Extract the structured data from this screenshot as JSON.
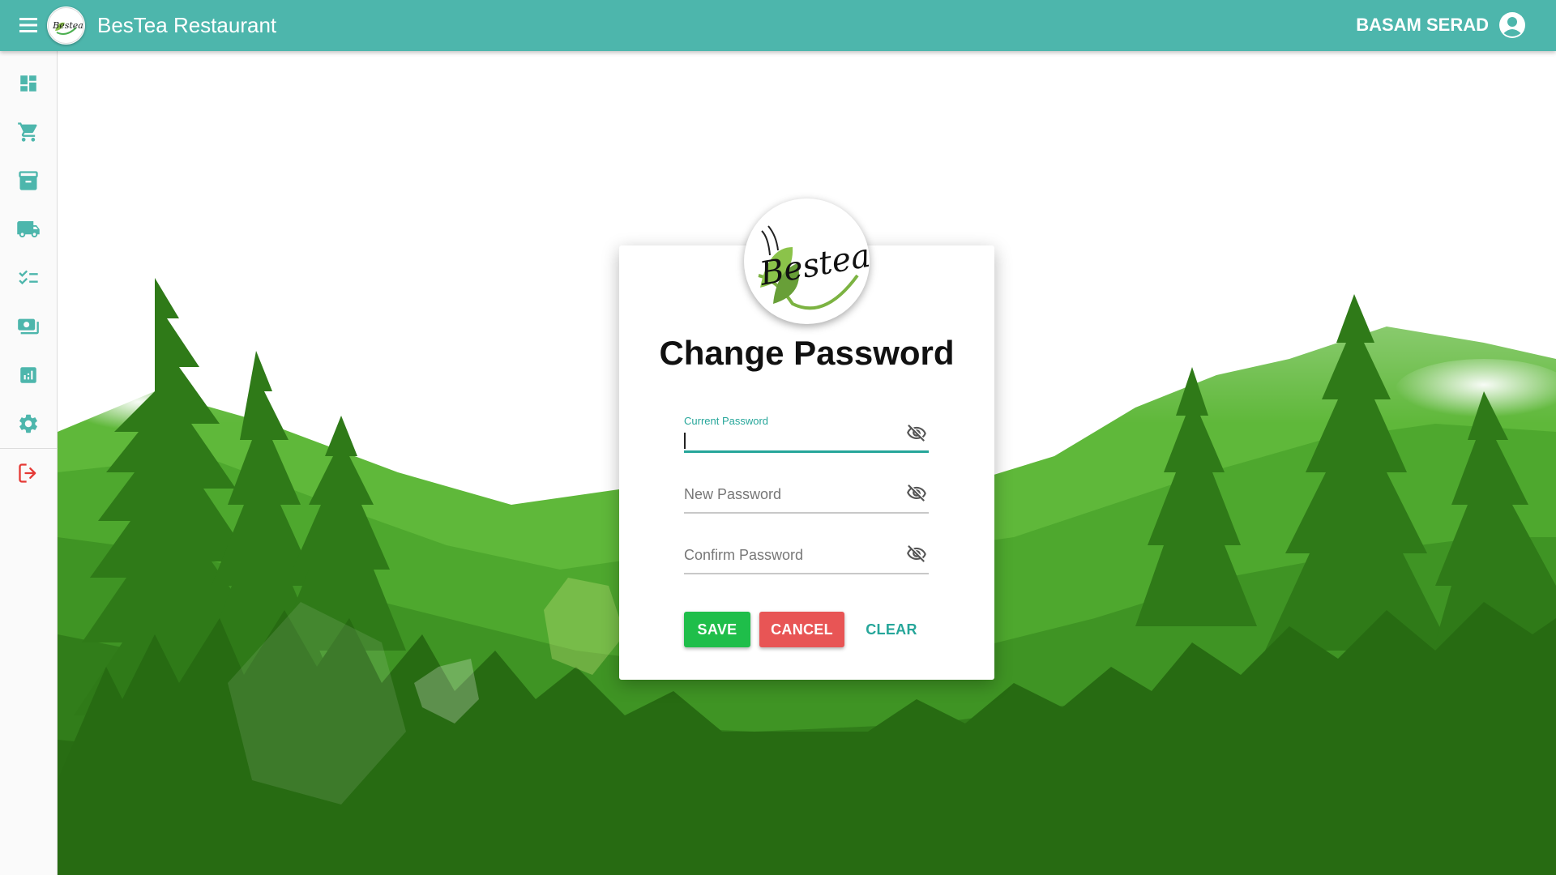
{
  "app": {
    "title": "BesTea Restaurant",
    "user_name": "BASAM SERAD",
    "accent": "#4db6ac"
  },
  "sidebar": {
    "items": [
      {
        "icon": "dashboard-icon"
      },
      {
        "icon": "cart-icon"
      },
      {
        "icon": "archive-icon"
      },
      {
        "icon": "truck-icon"
      },
      {
        "icon": "checklist-icon"
      },
      {
        "icon": "payments-icon"
      },
      {
        "icon": "report-icon"
      },
      {
        "icon": "gear-icon"
      },
      {
        "icon": "logout-icon"
      }
    ]
  },
  "form": {
    "title": "Change Password",
    "current_password_label": "Current Password",
    "new_password_placeholder": "New Password",
    "confirm_password_placeholder": "Confirm Password",
    "save_label": "SAVE",
    "cancel_label": "CANCEL",
    "clear_label": "CLEAR",
    "logo_text": "Bestea"
  },
  "colors": {
    "save": "#1fbe4a",
    "cancel": "#e85555",
    "clear": "#26a69a"
  }
}
